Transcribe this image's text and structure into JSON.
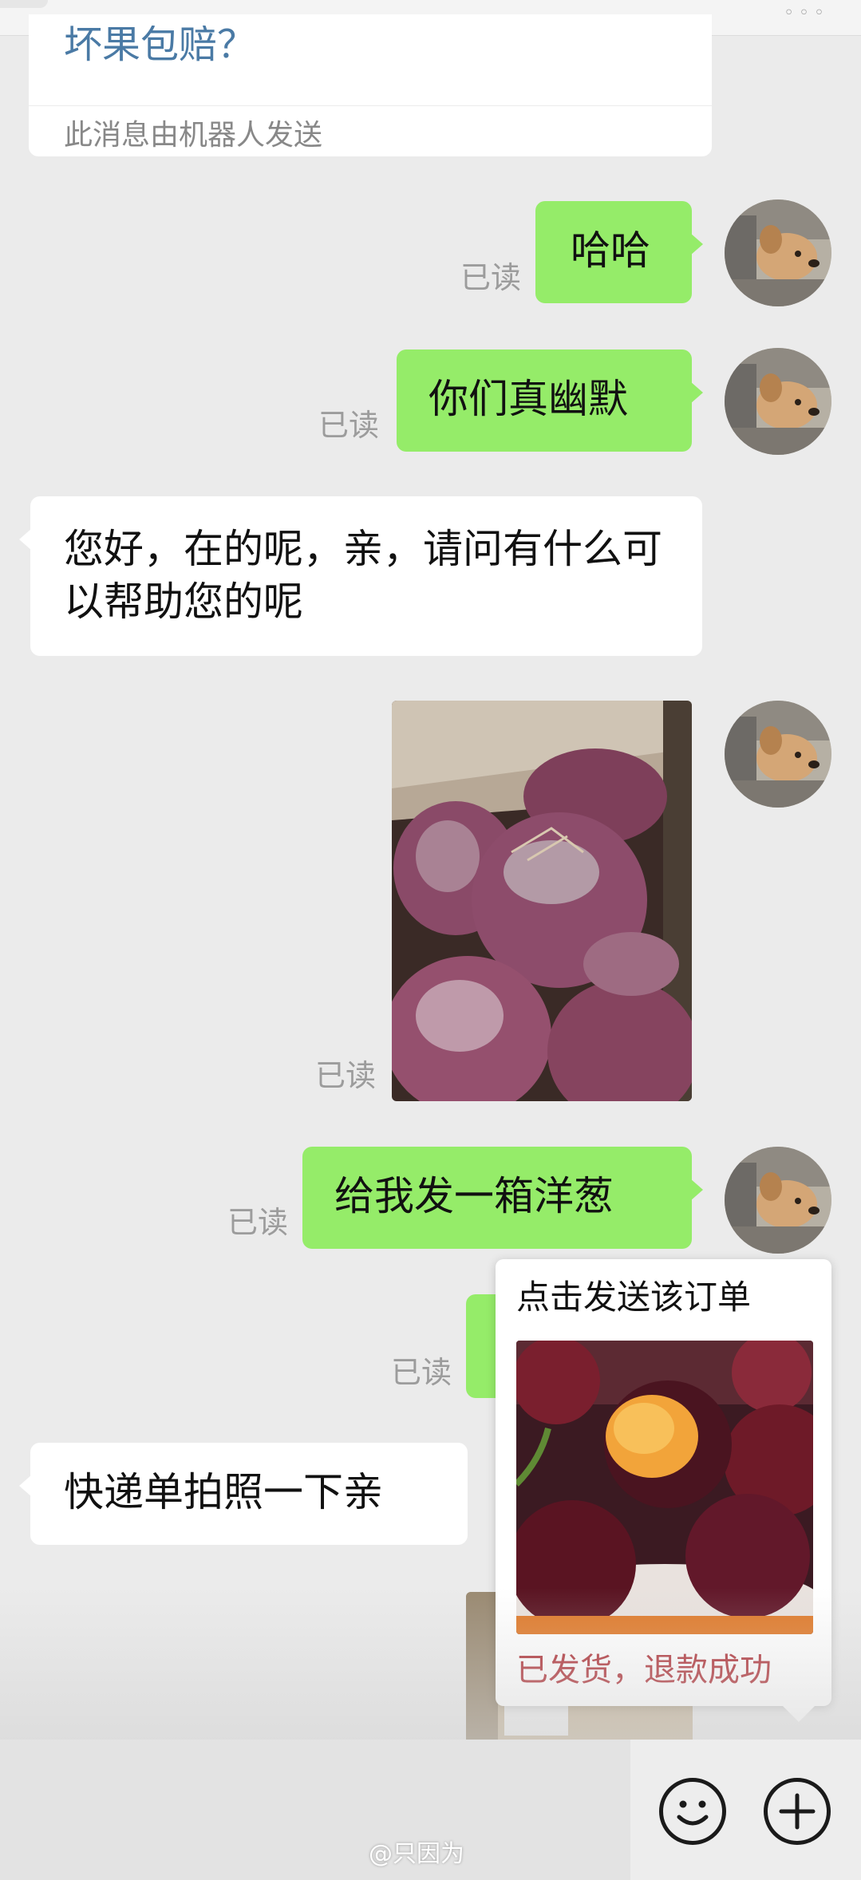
{
  "bot_card": {
    "cut_text": "坏果包赔？",
    "note": "此消息由机器人发送"
  },
  "messages": [
    {
      "text": "哈哈",
      "read": "已读"
    },
    {
      "text": "你们真幽默",
      "read": "已读"
    },
    {
      "text": "您好，在的呢，亲，请问有什么可以帮助您的呢"
    },
    {
      "read": "已读"
    },
    {
      "text": "给我发一箱洋葱",
      "read": "已读"
    },
    {
      "read": "已读"
    },
    {
      "text": "快递单拍照一下亲"
    }
  ],
  "order_popup": {
    "title": "点击发送该订单",
    "status": "已发货，退款成功"
  },
  "input_bar": {
    "emoji_icon": "smiley-icon",
    "plus_icon": "plus-icon"
  },
  "watermark": "@只因为",
  "colors": {
    "my_bubble": "#95ec69",
    "their_bubble": "#ffffff",
    "status_red": "#b0343a",
    "background": "#ebebeb"
  }
}
